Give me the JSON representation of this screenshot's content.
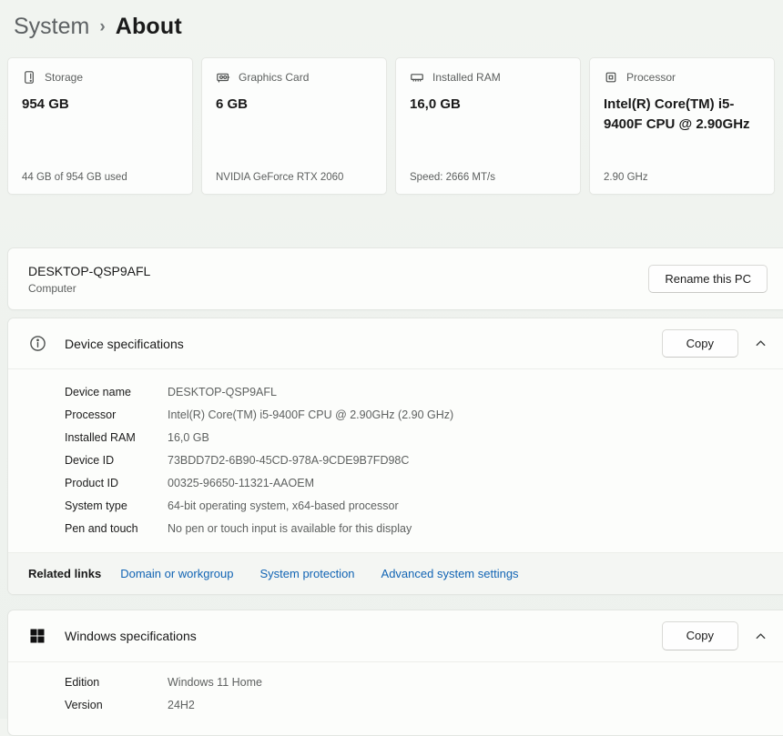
{
  "breadcrumb": {
    "parent": "System",
    "separator": "›",
    "current": "About"
  },
  "stat_cards": [
    {
      "icon": "storage-icon",
      "label": "Storage",
      "value": "954 GB",
      "detail": "44 GB of 954 GB used"
    },
    {
      "icon": "graphics-card-icon",
      "label": "Graphics Card",
      "value": "6 GB",
      "detail": "NVIDIA GeForce RTX 2060"
    },
    {
      "icon": "ram-icon",
      "label": "Installed RAM",
      "value": "16,0 GB",
      "detail": "Speed: 2666 MT/s"
    },
    {
      "icon": "processor-icon",
      "label": "Processor",
      "value": "Intel(R) Core(TM) i5-9400F CPU @ 2.90GHz",
      "detail": "2.90 GHz"
    }
  ],
  "computer": {
    "name": "DESKTOP-QSP9AFL",
    "subtitle": "Computer",
    "rename_button": "Rename this PC"
  },
  "device_specs": {
    "title": "Device specifications",
    "copy_button": "Copy",
    "rows": [
      {
        "label": "Device name",
        "value": "DESKTOP-QSP9AFL"
      },
      {
        "label": "Processor",
        "value": "Intel(R) Core(TM) i5-9400F CPU @ 2.90GHz (2.90 GHz)"
      },
      {
        "label": "Installed RAM",
        "value": "16,0 GB"
      },
      {
        "label": "Device ID",
        "value": "73BDD7D2-6B90-45CD-978A-9CDE9B7FD98C"
      },
      {
        "label": "Product ID",
        "value": "00325-96650-11321-AAOEM"
      },
      {
        "label": "System type",
        "value": "64-bit operating system, x64-based processor"
      },
      {
        "label": "Pen and touch",
        "value": "No pen or touch input is available for this display"
      }
    ],
    "related": {
      "title": "Related links",
      "links": [
        "Domain or workgroup",
        "System protection",
        "Advanced system settings"
      ]
    }
  },
  "windows_specs": {
    "title": "Windows specifications",
    "copy_button": "Copy",
    "rows": [
      {
        "label": "Edition",
        "value": "Windows 11 Home"
      },
      {
        "label": "Version",
        "value": "24H2"
      }
    ]
  },
  "colors": {
    "link": "#1164b4",
    "card-bg": "#fcfdfc",
    "page-bg": "#eef2ee",
    "windows-logo": "#111111"
  }
}
